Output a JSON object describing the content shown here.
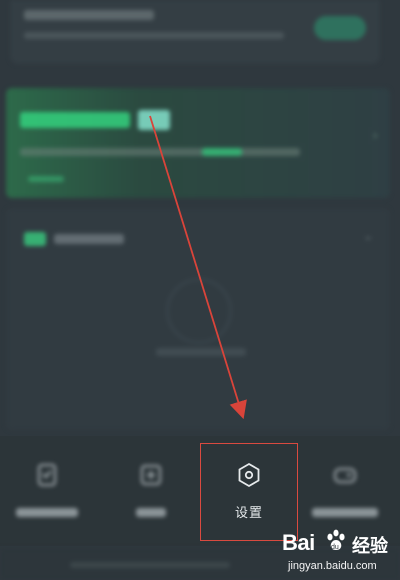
{
  "bottom_nav": {
    "settings_label": "设置"
  },
  "watermark": {
    "logo_bai": "Bai",
    "logo_du": "du",
    "logo_jingyan": "经验",
    "url": "jingyan.baidu.com"
  },
  "colors": {
    "accent_green": "#34d17e",
    "highlight_red": "#d94a40",
    "background": "#2f383e"
  },
  "icons": {
    "settings": "hexagon-settings-icon",
    "blurred_nav_1": "document-icon",
    "blurred_nav_2": "calendar-icon",
    "blurred_nav_4": "gamepad-icon"
  }
}
